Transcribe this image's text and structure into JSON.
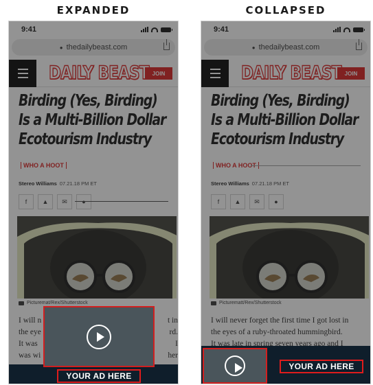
{
  "panels": {
    "expanded_label": "EXPANDED",
    "collapsed_label": "COLLAPSED"
  },
  "status": {
    "time": "9:41"
  },
  "browser": {
    "url": "thedailybeast.com",
    "lock_icon": "lock-icon",
    "share_icon": "share-icon"
  },
  "nav": {
    "logo": "DAILY BEAST",
    "join": "JOIN",
    "menu_icon": "hamburger-icon"
  },
  "article": {
    "headline": "Birding (Yes, Birding) Is a Multi-Billion Dollar Ecotourism Industry",
    "kicker": "WHO A HOOT",
    "author": "Stereo Williams",
    "date": "07.21.18 PM ET",
    "share_icons": [
      "facebook-icon",
      "twitter-icon",
      "email-icon",
      "reddit-icon"
    ],
    "caption_expanded": "Picturemat/Rex/Shutterstock",
    "caption_collapsed": "Picturematt/Rex/Shutterstock",
    "body_expanded": [
      "I will n",
      "t in",
      "the eye",
      "rd.",
      "It was",
      "I",
      "was wi",
      "her"
    ],
    "body_collapsed": [
      "I will never forget the first time I got lost in",
      "the eyes of a ruby-throated hummingbird.",
      "It was late in spring seven years ago and I"
    ]
  },
  "ad": {
    "label": "YOUR AD HERE",
    "play_icon": "play-icon"
  },
  "colors": {
    "brand_red": "#d81b1b",
    "ad_strip": "#0f1e2b",
    "video": "#4a555b"
  }
}
